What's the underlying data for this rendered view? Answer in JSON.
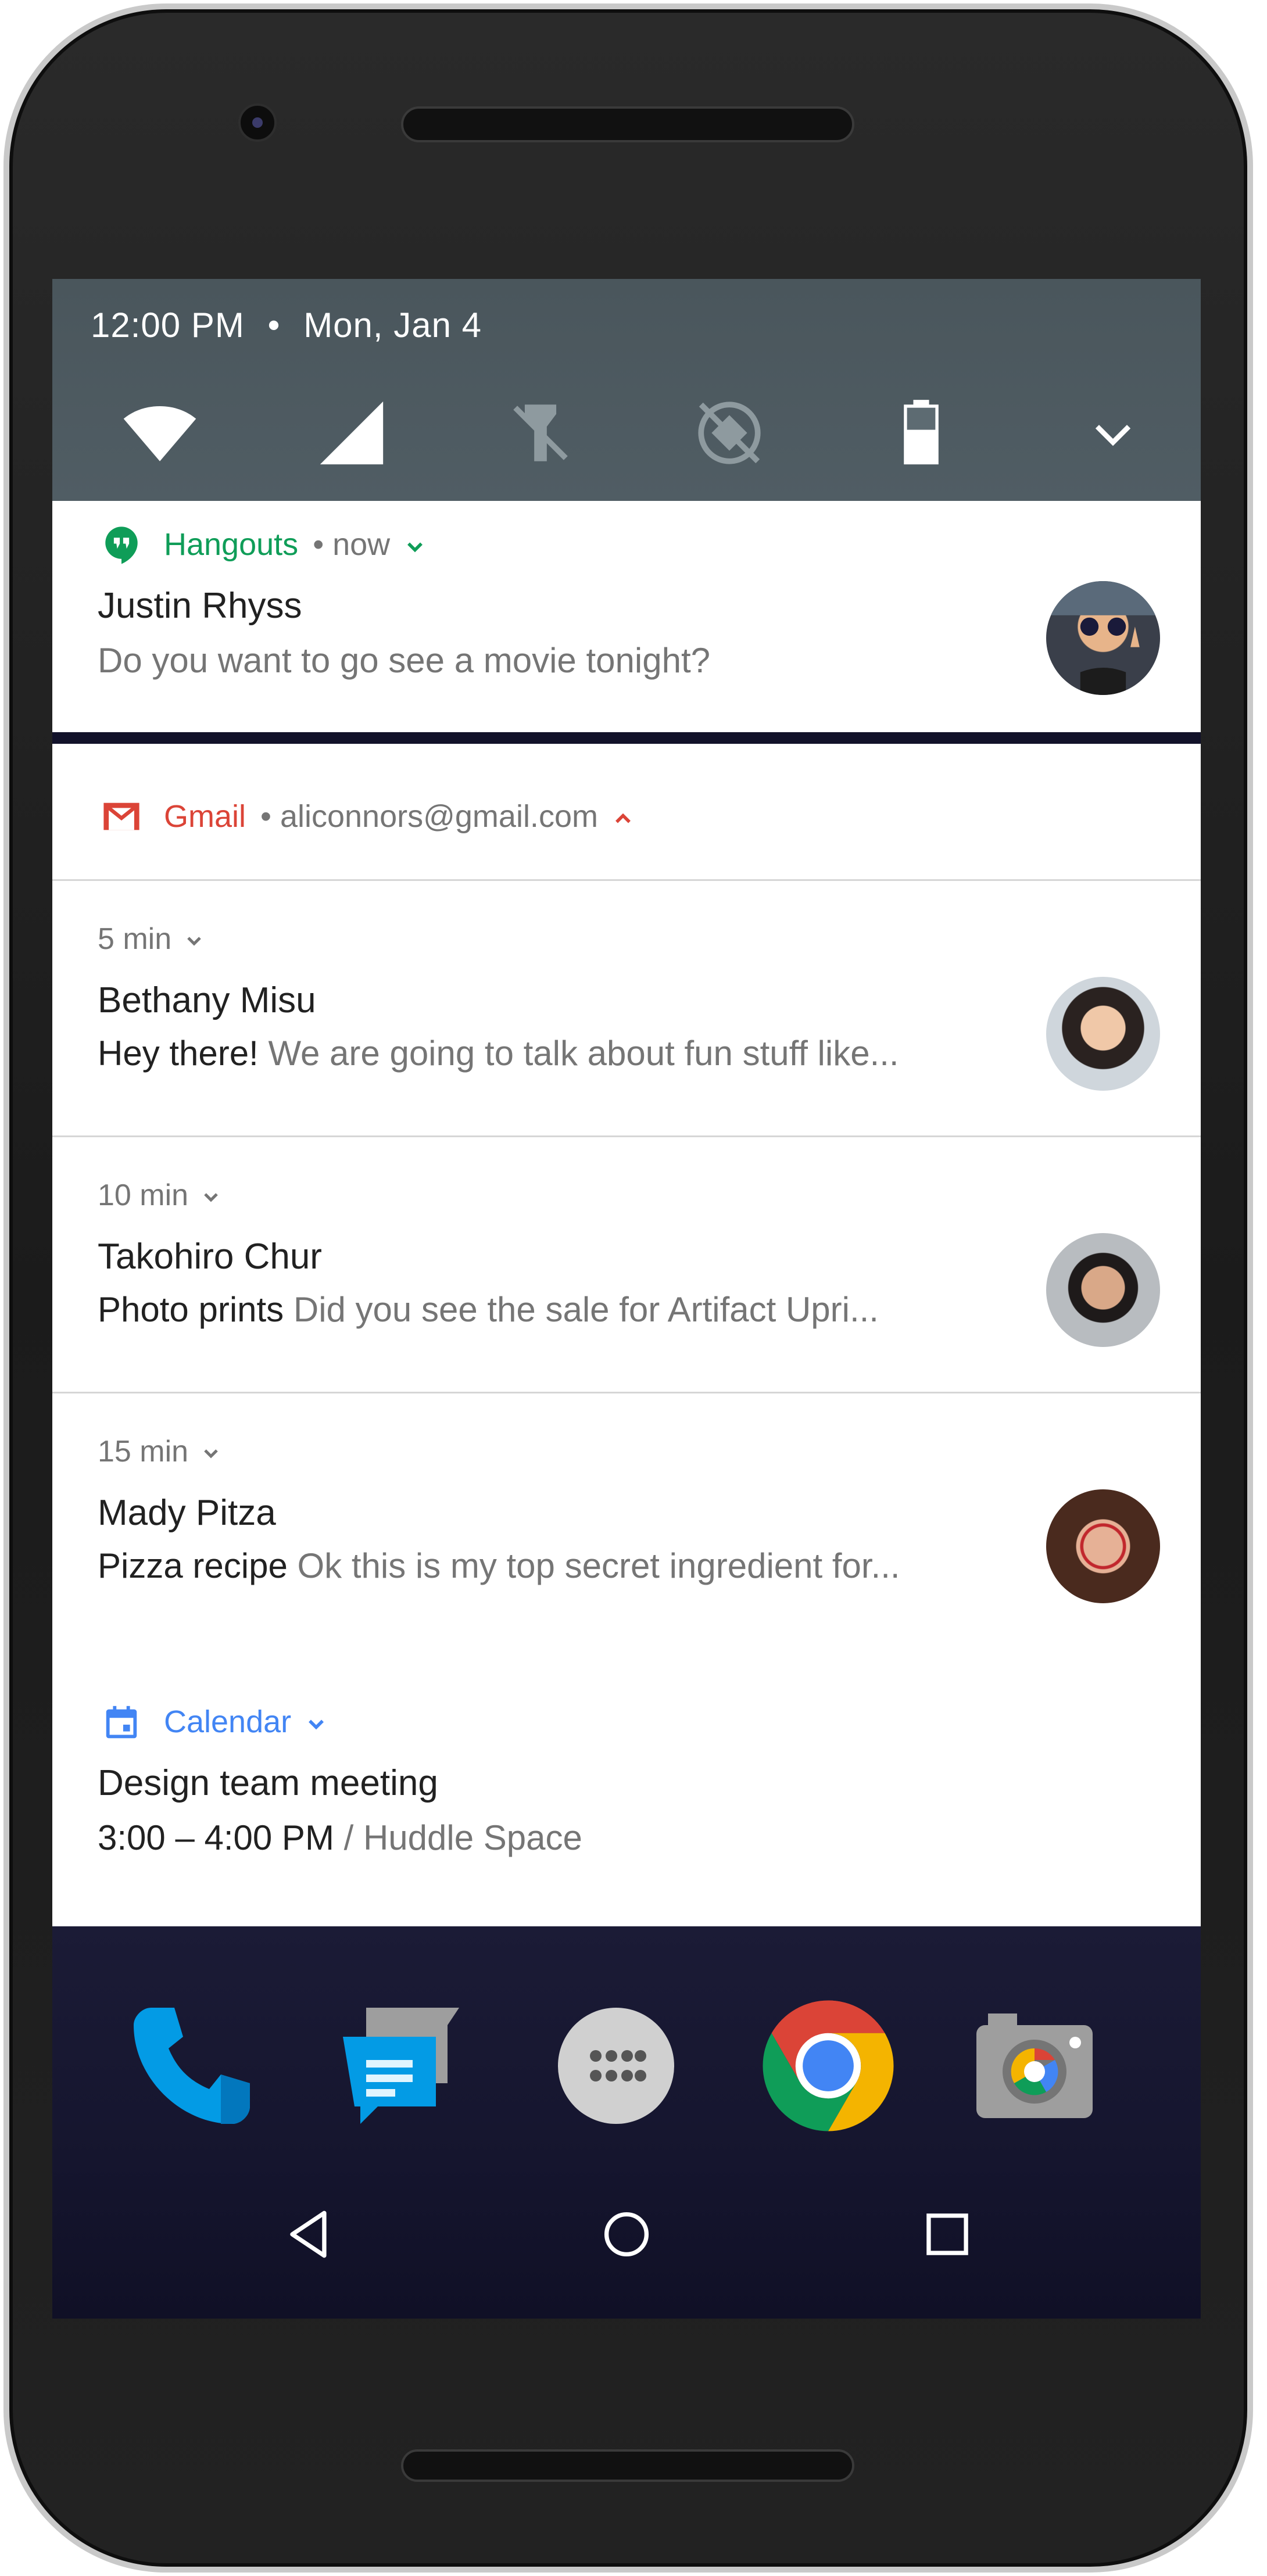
{
  "status": {
    "time": "12:00 PM",
    "separator": "•",
    "date": "Mon, Jan 4"
  },
  "quick_settings": [
    {
      "name": "wifi-icon"
    },
    {
      "name": "cellular-signal-icon"
    },
    {
      "name": "flashlight-off-icon"
    },
    {
      "name": "auto-rotate-off-icon"
    },
    {
      "name": "battery-icon"
    },
    {
      "name": "expand-chevron-icon"
    }
  ],
  "hangouts": {
    "app_name": "Hangouts",
    "time": "• now",
    "sender": "Justin Rhyss",
    "message": "Do you want to go see a movie tonight?",
    "color": "#0F9D58"
  },
  "gmail": {
    "app_name": "Gmail",
    "account": "• aliconnors@gmail.com",
    "color": "#DB4437",
    "messages": [
      {
        "time": "5 min",
        "sender": "Bethany Misu",
        "subject": "Hey there!",
        "preview": "We are going to talk about fun stuff like..."
      },
      {
        "time": "10 min",
        "sender": "Takohiro Chur",
        "subject": "Photo prints",
        "preview": "Did you see the sale for Artifact Upri..."
      },
      {
        "time": "15 min",
        "sender": "Mady Pitza",
        "subject": "Pizza recipe",
        "preview": "Ok this is my top secret ingredient for..."
      }
    ]
  },
  "calendar": {
    "app_name": "Calendar",
    "event": "Design team meeting",
    "time": "3:00 – 4:00 PM",
    "location": "/ Huddle Space",
    "color": "#4285F4"
  },
  "dock": [
    {
      "name": "phone-app-icon"
    },
    {
      "name": "messages-app-icon"
    },
    {
      "name": "app-drawer-icon"
    },
    {
      "name": "chrome-app-icon"
    },
    {
      "name": "camera-app-icon"
    }
  ],
  "nav": [
    "back-button",
    "home-button",
    "recents-button"
  ]
}
